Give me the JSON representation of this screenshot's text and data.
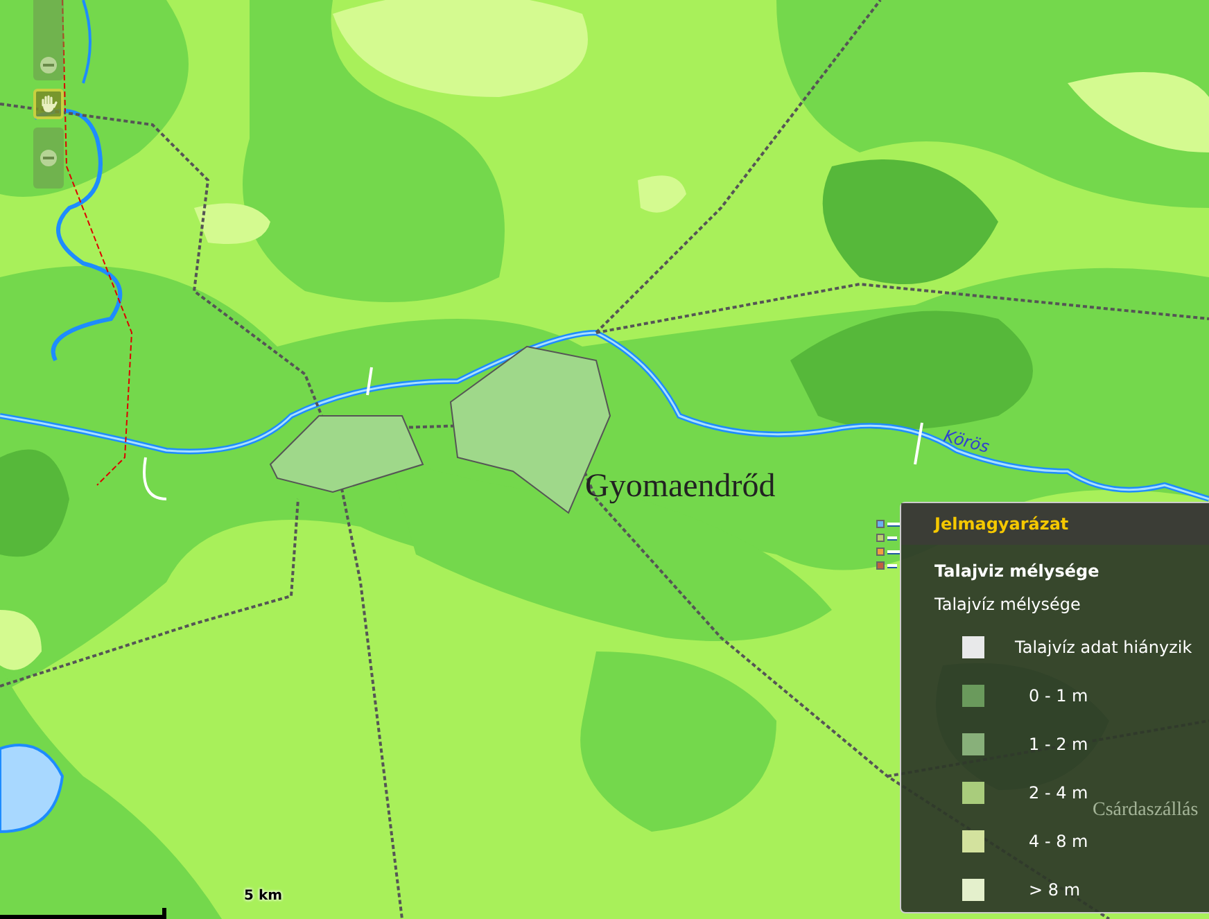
{
  "map": {
    "labels": [
      {
        "kind": "town",
        "text": "Gyomaendrőd"
      },
      {
        "kind": "river",
        "text": "Körös"
      },
      {
        "kind": "town",
        "text": "Csárdaszállás"
      }
    ],
    "scale": "5 km"
  },
  "nav_tools": [
    {
      "kind": "zoom_slider",
      "selected": false
    },
    {
      "kind": "pan",
      "selected": true
    },
    {
      "kind": "zoom_out",
      "selected": false
    }
  ],
  "legend": {
    "title": "Jelmagyarázat",
    "layer": "Talajviz mélysége",
    "subtitle": "Talajvíz mélysége",
    "items": [
      {
        "label": "Talajvíz adat hiányzik",
        "color": "#e8e9ea"
      },
      {
        "label": "0 - 1 m",
        "color": "#6a9a5c"
      },
      {
        "label": "1 - 2 m",
        "color": "#88b07a"
      },
      {
        "label": "2 - 4 m",
        "color": "#a9cc7c"
      },
      {
        "label": "4 - 8 m",
        "color": "#d3e29e"
      },
      {
        "label": "> 8 m",
        "color": "#e4f0cc"
      }
    ]
  }
}
